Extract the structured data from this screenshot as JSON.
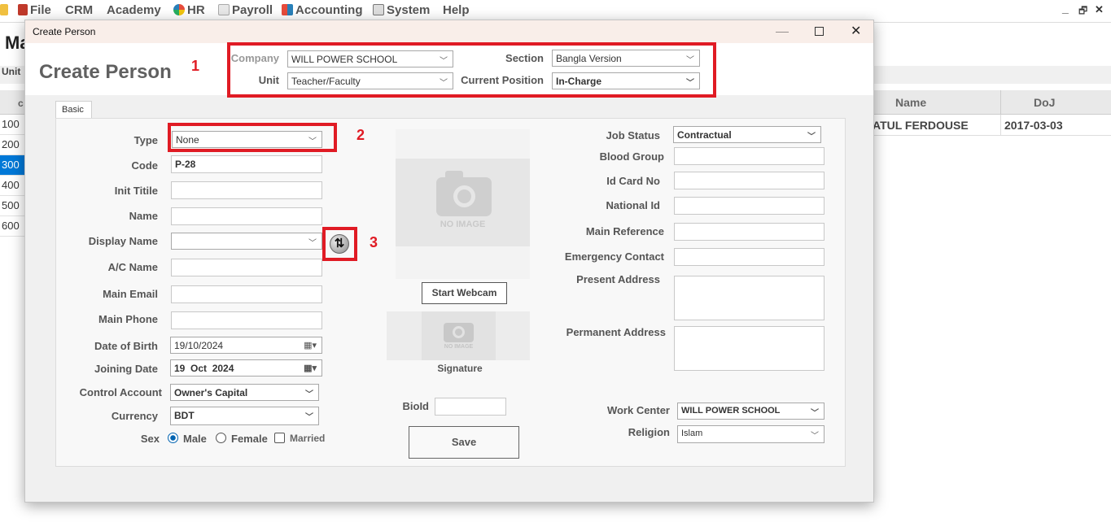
{
  "menu": {
    "items": [
      {
        "label": "File",
        "icon": "file-icon"
      },
      {
        "label": "CRM",
        "icon": ""
      },
      {
        "label": "Academy",
        "icon": ""
      },
      {
        "label": "HR",
        "icon": "hr-icon"
      },
      {
        "label": "Payroll",
        "icon": "payroll-icon"
      },
      {
        "label": "Accounting",
        "icon": "accounting-icon"
      },
      {
        "label": "System",
        "icon": "system-icon"
      },
      {
        "label": "Help",
        "icon": ""
      }
    ],
    "window_controls": {
      "minimize": "_",
      "restore": "🗗",
      "close": "✕"
    }
  },
  "background": {
    "title_partial": "Ma",
    "unit_partial": "Unit",
    "grid": {
      "code_header_partial": "c",
      "name_header": "Name",
      "doj_header": "DoJ",
      "codes": [
        "100",
        "200",
        "300",
        "400",
        "500",
        "600"
      ],
      "selected_index": 2,
      "first_row_name": "ATUL FERDOUSE",
      "first_row_doj": "2017-03-03"
    }
  },
  "dialog": {
    "window_title": "Create Person",
    "heading": "Create Person",
    "annotations": [
      "1",
      "2",
      "3"
    ],
    "header": {
      "company_label": "Company",
      "company_value": "WILL POWER SCHOOL",
      "unit_label": "Unit",
      "unit_value": "Teacher/Faculty",
      "section_label": "Section",
      "section_value": "Bangla Version",
      "position_label": "Current Position",
      "position_value": "In-Charge"
    },
    "tab": "Basic",
    "left": {
      "type_label": "Type",
      "type_value": "None",
      "code_label": "Code",
      "code_value": "P-28",
      "init_title_label": "Init Titile",
      "init_title_value": "",
      "name_label": "Name",
      "name_value": "",
      "display_name_label": "Display Name",
      "display_name_value": "",
      "ac_name_label": "A/C Name",
      "ac_name_value": "",
      "main_email_label": "Main Email",
      "main_email_value": "",
      "main_phone_label": "Main Phone",
      "main_phone_value": "",
      "dob_label": "Date of Birth",
      "dob_value": "19/10/2024",
      "joining_label": "Joining Date",
      "joining_value": "19  Oct  2024",
      "control_account_label": "Control Account",
      "control_account_value": "Owner's Capital",
      "currency_label": "Currency",
      "currency_value": "BDT",
      "sex_label": "Sex",
      "male_label": "Male",
      "female_label": "Female",
      "married_label": "Married"
    },
    "middle": {
      "no_image_text": "NO IMAGE",
      "start_webcam": "Start Webcam",
      "signature_no_image": "NO IMAGE",
      "signature_label": "Signature",
      "bioid_label": "BioId",
      "bioid_value": "",
      "save": "Save"
    },
    "right": {
      "job_status_label": "Job Status",
      "job_status_value": "Contractual",
      "blood_group_label": "Blood Group",
      "id_card_label": "Id Card No",
      "national_id_label": "National Id",
      "main_reference_label": "Main Reference",
      "emergency_contact_label": "Emergency Contact",
      "present_address_label": "Present Address",
      "permanent_address_label": "Permanent Address",
      "work_center_label": "Work Center",
      "work_center_value": "WILL POWER SCHOOL",
      "religion_label": "Religion",
      "religion_value": "Islam"
    }
  },
  "colors": {
    "annotation_red": "#e01b24",
    "selected_row": "#0078d7"
  }
}
